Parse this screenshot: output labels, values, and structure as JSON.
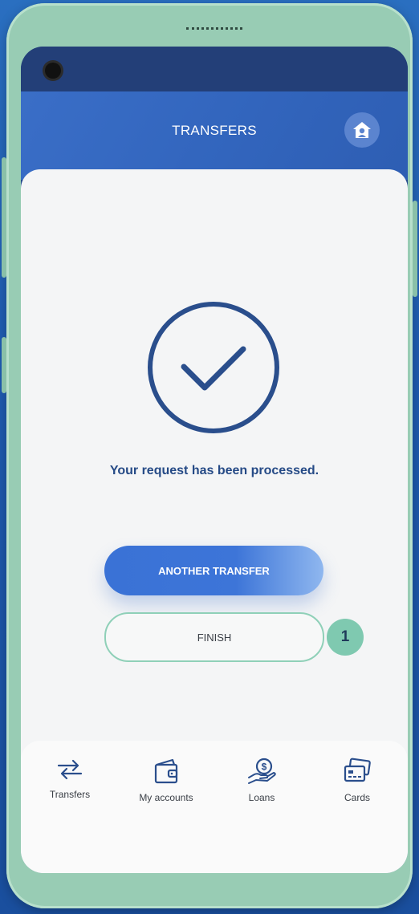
{
  "header": {
    "title": "TRANSFERS"
  },
  "main": {
    "message": "Your request has been processed.",
    "primary_button": "ANOTHER TRANSFER",
    "secondary_button": "FINISH",
    "step_badge": "1"
  },
  "tabbar": {
    "items": [
      {
        "label": "Transfers",
        "icon": "transfer-arrows-icon"
      },
      {
        "label": "My accounts",
        "icon": "wallet-icon"
      },
      {
        "label": "Loans",
        "icon": "hand-coin-icon"
      },
      {
        "label": "Cards",
        "icon": "cards-icon"
      }
    ]
  },
  "colors": {
    "brand_blue": "#3a6ec7",
    "text_navy": "#254a86",
    "accent_mint": "#7fc9b0"
  }
}
